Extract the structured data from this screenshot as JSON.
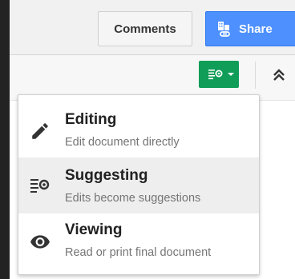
{
  "header": {
    "comments_label": "Comments",
    "share_label": "Share",
    "share_icon": "share-people-icon"
  },
  "toolbar": {
    "mode_icon": "suggesting-icon",
    "collapse_icon": "double-chevron-up-icon"
  },
  "mode_menu": {
    "selected": "suggesting",
    "items": [
      {
        "id": "editing",
        "label": "Editing",
        "description": "Edit document directly",
        "icon": "pencil-icon"
      },
      {
        "id": "suggesting",
        "label": "Suggesting",
        "description": "Edits become suggestions",
        "icon": "suggesting-icon"
      },
      {
        "id": "viewing",
        "label": "Viewing",
        "description": "Read or print final document",
        "icon": "eye-icon"
      }
    ]
  },
  "colors": {
    "share_blue": "#4d90fe",
    "mode_green": "#0f9d58",
    "selected_row": "#eeeeee"
  }
}
